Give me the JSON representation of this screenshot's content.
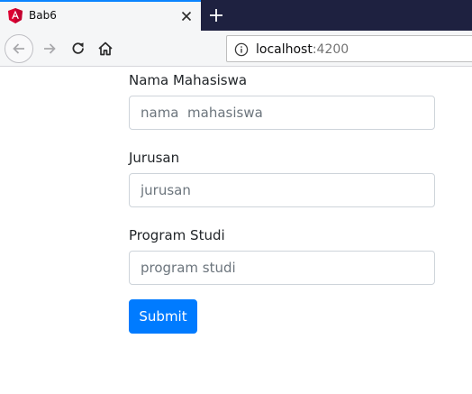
{
  "browser": {
    "tab_title": "Bab6",
    "url_host": "localhost",
    "url_port": ":4200",
    "icons": {
      "favicon": "angular-logo-icon",
      "close": "close-icon",
      "new_tab": "plus-icon",
      "back": "back-arrow-icon",
      "forward": "forward-arrow-icon",
      "reload": "reload-icon",
      "home": "home-icon",
      "site_info": "info-icon"
    },
    "colors": {
      "tab_accent": "#0a84ff",
      "tabstrip_bg": "#1e2140",
      "angular_red": "#dd0031"
    }
  },
  "form": {
    "fields": [
      {
        "label": "Nama Mahasiswa",
        "placeholder": "nama  mahasiswa"
      },
      {
        "label": "Jurusan",
        "placeholder": "jurusan"
      },
      {
        "label": "Program Studi",
        "placeholder": "program studi"
      }
    ],
    "submit_label": "Submit",
    "colors": {
      "primary": "#007bff"
    }
  }
}
